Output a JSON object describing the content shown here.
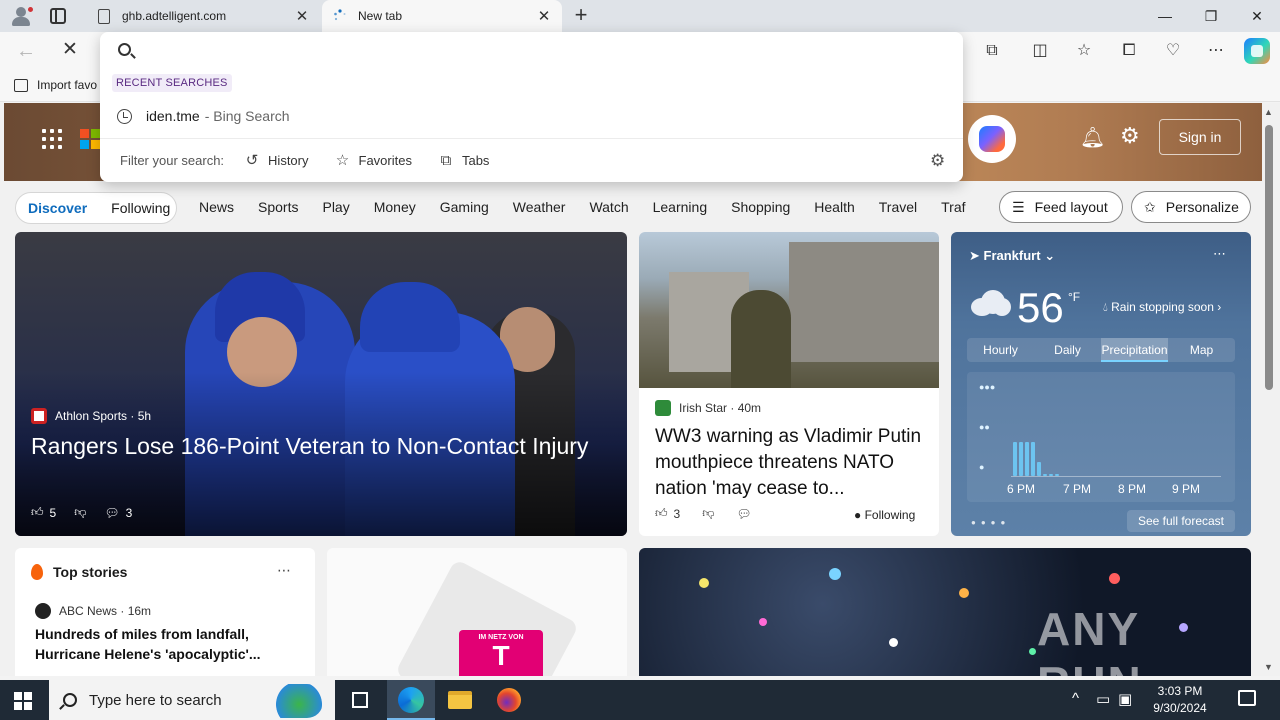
{
  "browser": {
    "tabs": [
      {
        "title": "ghb.adtelligent.com"
      },
      {
        "title": "New tab"
      }
    ],
    "new_tab_symbol": "+",
    "window_controls": {
      "minimize": "—",
      "maximize": "❐",
      "close": "✕"
    },
    "favorites_bar": {
      "import_label": "Import favo"
    }
  },
  "omnibox": {
    "value": "",
    "placeholder": "",
    "recent_label": "RECENT SEARCHES",
    "suggestion": {
      "query": "iden.tme",
      "source": "- Bing Search"
    },
    "filter_label": "Filter your search:",
    "filters": [
      "History",
      "Favorites",
      "Tabs"
    ]
  },
  "newtab": {
    "sign_in": "Sign in",
    "segments": [
      "Discover",
      "Following"
    ],
    "categories": [
      "News",
      "Sports",
      "Play",
      "Money",
      "Gaming",
      "Weather",
      "Watch",
      "Learning",
      "Shopping",
      "Health",
      "Travel",
      "Traf"
    ],
    "feed_layout": "Feed layout",
    "personalize": "Personalize"
  },
  "hero_story": {
    "source": "Athlon Sports",
    "age": "· 5h",
    "headline": "Rangers Lose 186-Point Veteran to Non-Contact Injury",
    "likes": "5",
    "comments": "3"
  },
  "story2": {
    "source": "Irish Star",
    "age": "· 40m",
    "headline": "WW3 warning as Vladimir Putin mouthpiece threatens NATO nation 'may cease to...",
    "likes": "3",
    "following": "Following"
  },
  "weather": {
    "city": "Frankfurt",
    "temp": "56",
    "unit": "°F",
    "condition": "Rain stopping soon",
    "tabs": [
      "Hourly",
      "Daily",
      "Precipitation",
      "Map"
    ],
    "active_tab": "Precipitation",
    "times": [
      "6 PM",
      "7 PM",
      "8 PM",
      "9 PM"
    ],
    "precip_levels": [
      0.85,
      0.85,
      0.85,
      0.85,
      0.35,
      0.05,
      0.05,
      0.05
    ],
    "full_forecast": "See full forecast"
  },
  "top_stories": {
    "title": "Top stories",
    "source": "ABC News",
    "age": "· 16m",
    "headline": "Hundreds of miles from landfall, Hurricane Helene's 'apocalyptic'..."
  },
  "ad_card": {
    "top_text": "IM NETZ VON",
    "logo_letter": "T"
  },
  "watermark": "ANY RUN",
  "taskbar": {
    "search_placeholder": "Type here to search",
    "time": "3:03 PM",
    "date": "9/30/2024"
  }
}
